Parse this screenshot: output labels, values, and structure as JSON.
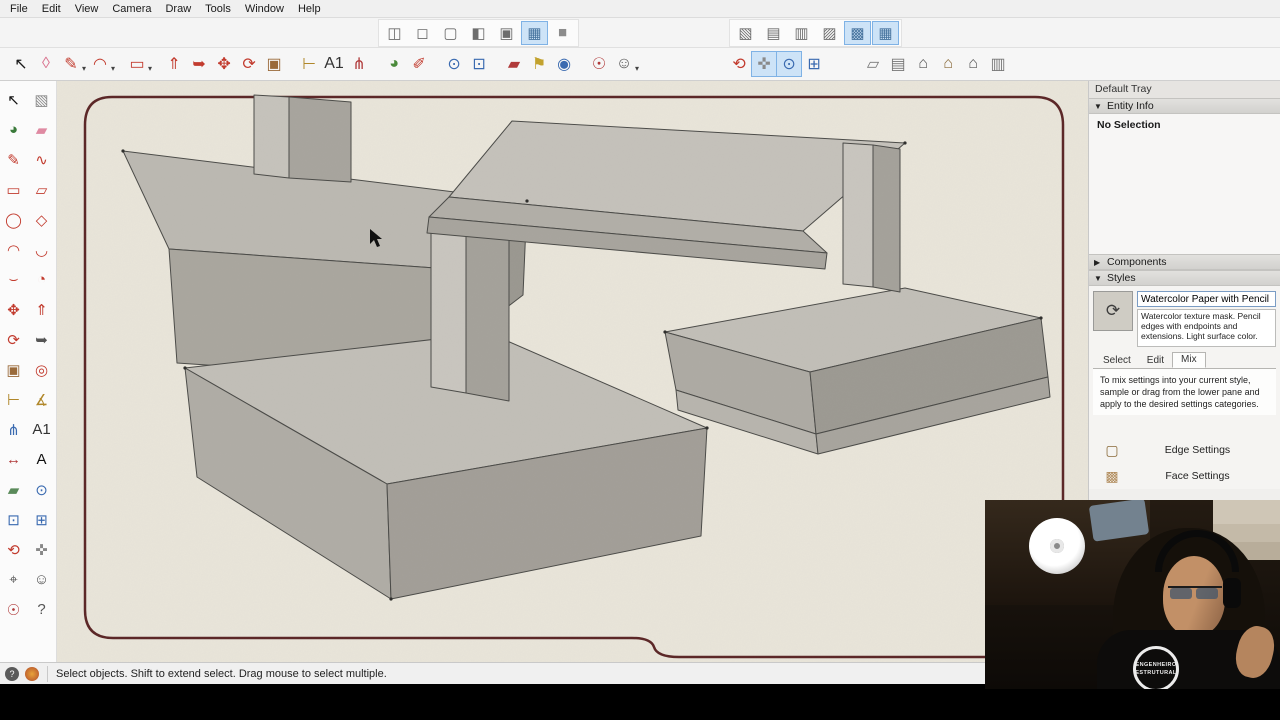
{
  "colors": {
    "accent_pressed": "#cde3f7",
    "accent_border": "#7fb2e5",
    "paper": "#e9e5da",
    "paper_border": "#5b2626",
    "model_gray_light": "#c6c3bc",
    "model_gray_mid": "#b0ada6",
    "model_gray_dark": "#9d9a93"
  },
  "menu": {
    "items": [
      {
        "name": "menu-file",
        "label": "File"
      },
      {
        "name": "menu-edit",
        "label": "Edit"
      },
      {
        "name": "menu-view",
        "label": "View"
      },
      {
        "name": "menu-camera",
        "label": "Camera"
      },
      {
        "name": "menu-draw",
        "label": "Draw"
      },
      {
        "name": "menu-tools",
        "label": "Tools"
      },
      {
        "name": "menu-window",
        "label": "Window"
      },
      {
        "name": "menu-help",
        "label": "Help"
      }
    ]
  },
  "styles_toolbar": {
    "group1": [
      {
        "name": "xray-mode-icon",
        "glyph": "◫",
        "color": "#6d6d6d",
        "pressed": false
      },
      {
        "name": "back-edges-icon",
        "glyph": "◻",
        "color": "#6d6d6d",
        "pressed": false
      },
      {
        "name": "wireframe-icon",
        "glyph": "▢",
        "color": "#6d6d6d",
        "pressed": false
      },
      {
        "name": "hidden-line-icon",
        "glyph": "◧",
        "color": "#6d6d6d",
        "pressed": false
      },
      {
        "name": "shaded-icon",
        "glyph": "▣",
        "color": "#6d6d6d",
        "pressed": false
      },
      {
        "name": "shaded-with-textures-icon",
        "glyph": "▦",
        "color": "#44719c",
        "pressed": true
      },
      {
        "name": "monochrome-icon",
        "glyph": "■",
        "color": "#8c8c8c",
        "pressed": false
      }
    ],
    "group2": [
      {
        "name": "iso-view-icon",
        "glyph": "▧",
        "color": "#6d6d6d",
        "pressed": false
      },
      {
        "name": "top-view-icon",
        "glyph": "▤",
        "color": "#6d6d6d",
        "pressed": false
      },
      {
        "name": "front-view-icon",
        "glyph": "▥",
        "color": "#6d6d6d",
        "pressed": false
      },
      {
        "name": "right-view-icon",
        "glyph": "▨",
        "color": "#6d6d6d",
        "pressed": false
      },
      {
        "name": "back-view-icon",
        "glyph": "▩",
        "color": "#44719c",
        "pressed": true
      },
      {
        "name": "left-view-icon",
        "glyph": "▦",
        "color": "#44719c",
        "pressed": true
      }
    ]
  },
  "main_toolbar": {
    "items": [
      {
        "name": "select-tool-icon",
        "glyph": "↖",
        "color": "#1a1a1a"
      },
      {
        "name": "eraser-tool-icon",
        "glyph": "◊",
        "color": "#d9738f"
      },
      {
        "name": "line-tool-icon",
        "glyph": "✎",
        "color": "#c23b2e",
        "dd": "▾"
      },
      {
        "name": "arc-tool-icon",
        "glyph": "◠",
        "color": "#c23b2e",
        "dd": "▾"
      },
      {
        "name": "rectangle-tool-icon",
        "glyph": "▭",
        "color": "#c23b2e",
        "dd": "▾",
        "ml": "8px"
      },
      {
        "name": "push-pull-tool-icon",
        "glyph": "⇑",
        "color": "#c23b2e",
        "ml": "8px"
      },
      {
        "name": "follow-me-tool-icon",
        "glyph": "➥",
        "color": "#c23b2e"
      },
      {
        "name": "move-tool-icon",
        "glyph": "✥",
        "color": "#c23b2e"
      },
      {
        "name": "rotate-tool-icon",
        "glyph": "⟳",
        "color": "#c23b2e"
      },
      {
        "name": "scale-tool-icon",
        "glyph": "▣",
        "color": "#9a6a3a"
      },
      {
        "name": "tape-measure-tool-icon",
        "glyph": "⊢",
        "color": "#b0872a",
        "ml": "10px"
      },
      {
        "name": "text-tool-icon",
        "glyph": "A1",
        "color": "#333333"
      },
      {
        "name": "axes-tool-icon",
        "glyph": "⋔",
        "color": "#b03a3a"
      },
      {
        "name": "paint-bucket-tool-icon",
        "glyph": "◕",
        "color": "#4a8a3a",
        "ml": "10px"
      },
      {
        "name": "sample-paint-tool-icon",
        "glyph": "✐",
        "color": "#c23b2e"
      },
      {
        "name": "zoom-tool-icon",
        "glyph": "⊙",
        "color": "#3a6ab0",
        "ml": "10px"
      },
      {
        "name": "zoom-window-tool-icon",
        "glyph": "⊡",
        "color": "#3a6ab0"
      },
      {
        "name": "section-plane-tool-icon",
        "glyph": "▰",
        "color": "#b03a3a",
        "ml": "10px"
      },
      {
        "name": "add-location-tool-icon",
        "glyph": "⚑",
        "color": "#c2a22e"
      },
      {
        "name": "geo-model-tool-icon",
        "glyph": "◉",
        "color": "#3a6ab0"
      },
      {
        "name": "look-around-tool-icon",
        "glyph": "☉",
        "color": "#b03a3a",
        "ml": "10px"
      },
      {
        "name": "walk-avatar-icon",
        "glyph": "☺",
        "color": "#555555",
        "dd": "▾"
      },
      {
        "name": "orbit-tool-icon",
        "glyph": "⟲",
        "color": "#c23b2e",
        "ml": "86px"
      },
      {
        "name": "pan-tool-icon",
        "glyph": "✜",
        "color": "#8a8a8a",
        "pressed": true
      },
      {
        "name": "zoom-tool-2-icon",
        "glyph": "⊙",
        "color": "#3a6ab0",
        "pressed": true
      },
      {
        "name": "zoom-extents-tool-icon",
        "glyph": "⊞",
        "color": "#3a6ab0"
      },
      {
        "name": "section-display-icon",
        "glyph": "▱",
        "color": "#777777",
        "ml": "34px"
      },
      {
        "name": "materials-browser-icon",
        "glyph": "▤",
        "color": "#777777"
      },
      {
        "name": "home-icon",
        "glyph": "⌂",
        "color": "#555555"
      },
      {
        "name": "warehouse-icon",
        "glyph": "⌂",
        "color": "#8a6a3a"
      },
      {
        "name": "extension-warehouse-icon",
        "glyph": "⌂",
        "color": "#555555"
      },
      {
        "name": "trays-icon",
        "glyph": "▥",
        "color": "#777777"
      }
    ]
  },
  "left_toolbar": {
    "items": [
      {
        "name": "lt-select-icon",
        "glyph": "↖",
        "color": "#111111"
      },
      {
        "name": "lt-make-component-icon",
        "glyph": "▧",
        "color": "#8a8a8a"
      },
      {
        "name": "lt-paint-bucket-icon",
        "glyph": "◕",
        "color": "#3a7a3a"
      },
      {
        "name": "lt-eraser-icon",
        "glyph": "▰",
        "color": "#df8aa2"
      },
      {
        "name": "lt-line-icon",
        "glyph": "✎",
        "color": "#c23b2e"
      },
      {
        "name": "lt-freehand-icon",
        "glyph": "∿",
        "color": "#c23b2e"
      },
      {
        "name": "lt-rectangle-icon",
        "glyph": "▭",
        "color": "#c23b2e"
      },
      {
        "name": "lt-rotated-rectangle-icon",
        "glyph": "▱",
        "color": "#c23b2e"
      },
      {
        "name": "lt-circle-icon",
        "glyph": "◯",
        "color": "#c23b2e"
      },
      {
        "name": "lt-polygon-icon",
        "glyph": "◇",
        "color": "#c23b2e"
      },
      {
        "name": "lt-arc-icon",
        "glyph": "◠",
        "color": "#c23b2e"
      },
      {
        "name": "lt-two-point-arc-icon",
        "glyph": "◡",
        "color": "#c23b2e"
      },
      {
        "name": "lt-three-point-arc-icon",
        "glyph": "⌣",
        "color": "#c23b2e"
      },
      {
        "name": "lt-pie-icon",
        "glyph": "◔",
        "color": "#c23b2e"
      },
      {
        "name": "lt-move-icon",
        "glyph": "✥",
        "color": "#c23b2e"
      },
      {
        "name": "lt-push-pull-icon",
        "glyph": "⇑",
        "color": "#c23b2e"
      },
      {
        "name": "lt-rotate-icon",
        "glyph": "⟳",
        "color": "#c23b2e"
      },
      {
        "name": "lt-follow-me-icon",
        "glyph": "➥",
        "color": "#555555"
      },
      {
        "name": "lt-scale-icon",
        "glyph": "▣",
        "color": "#9a6a3a"
      },
      {
        "name": "lt-offset-icon",
        "glyph": "◎",
        "color": "#c23b2e"
      },
      {
        "name": "lt-tape-measure-icon",
        "glyph": "⊢",
        "color": "#b0872a"
      },
      {
        "name": "lt-protractor-icon",
        "glyph": "∡",
        "color": "#b0872a"
      },
      {
        "name": "lt-axes-icon",
        "glyph": "⋔",
        "color": "#3a6ab0"
      },
      {
        "name": "lt-text-icon",
        "glyph": "A1",
        "color": "#333333"
      },
      {
        "name": "lt-dimension-icon",
        "glyph": "↔",
        "color": "#b03a3a"
      },
      {
        "name": "lt-3d-text-icon",
        "glyph": "A",
        "color": "#111111"
      },
      {
        "name": "lt-section-plane-icon",
        "glyph": "▰",
        "color": "#5a8a5a"
      },
      {
        "name": "lt-zoom-icon",
        "glyph": "⊙",
        "color": "#3a6ab0"
      },
      {
        "name": "lt-zoom-window-icon",
        "glyph": "⊡",
        "color": "#3a6ab0"
      },
      {
        "name": "lt-zoom-extents-icon",
        "glyph": "⊞",
        "color": "#3a6ab0"
      },
      {
        "name": "lt-orbit-icon",
        "glyph": "⟲",
        "color": "#c23b2e"
      },
      {
        "name": "lt-pan-icon",
        "glyph": "✜",
        "color": "#888888"
      },
      {
        "name": "lt-position-camera-icon",
        "glyph": "⌖",
        "color": "#555555"
      },
      {
        "name": "lt-walk-icon",
        "glyph": "☺",
        "color": "#555555"
      },
      {
        "name": "lt-look-around-icon",
        "glyph": "☉",
        "color": "#b03a3a"
      },
      {
        "name": "lt-help-icon",
        "glyph": "?",
        "color": "#555555"
      }
    ]
  },
  "tray": {
    "title": "Default Tray",
    "entity_info": {
      "arrow": "▼",
      "label": "Entity Info",
      "content": "No Selection"
    },
    "components": {
      "arrow": "▶",
      "label": "Components"
    },
    "styles": {
      "arrow": "▼",
      "label": "Styles",
      "thumb_glyph": "⟳",
      "style_name": "Watercolor Paper with Pencil",
      "description": "Watercolor texture mask. Pencil edges with endpoints and extensions.  Light surface color.",
      "tabs": [
        {
          "name": "tab-select",
          "label": "Select",
          "active": false
        },
        {
          "name": "tab-edit",
          "label": "Edit",
          "active": false
        },
        {
          "name": "tab-mix",
          "label": "Mix",
          "active": true
        }
      ],
      "mix_help": "To mix settings into your current style, sample or drag from the lower pane and apply to the desired settings categories.",
      "settings": [
        {
          "name": "edge-settings-row",
          "icon": "▢",
          "icon_color": "#8a6a3a",
          "label": "Edge Settings"
        },
        {
          "name": "face-settings-row",
          "icon": "▩",
          "icon_color": "#b08a5a",
          "label": "Face Settings"
        }
      ]
    }
  },
  "statusbar": {
    "help_glyph": "?",
    "text": "Select objects. Shift to extend select. Drag mouse to select multiple."
  },
  "webcam": {
    "emblem_line1": "ENGENHEIRO",
    "emblem_line2": "ESTRUTURAL"
  }
}
